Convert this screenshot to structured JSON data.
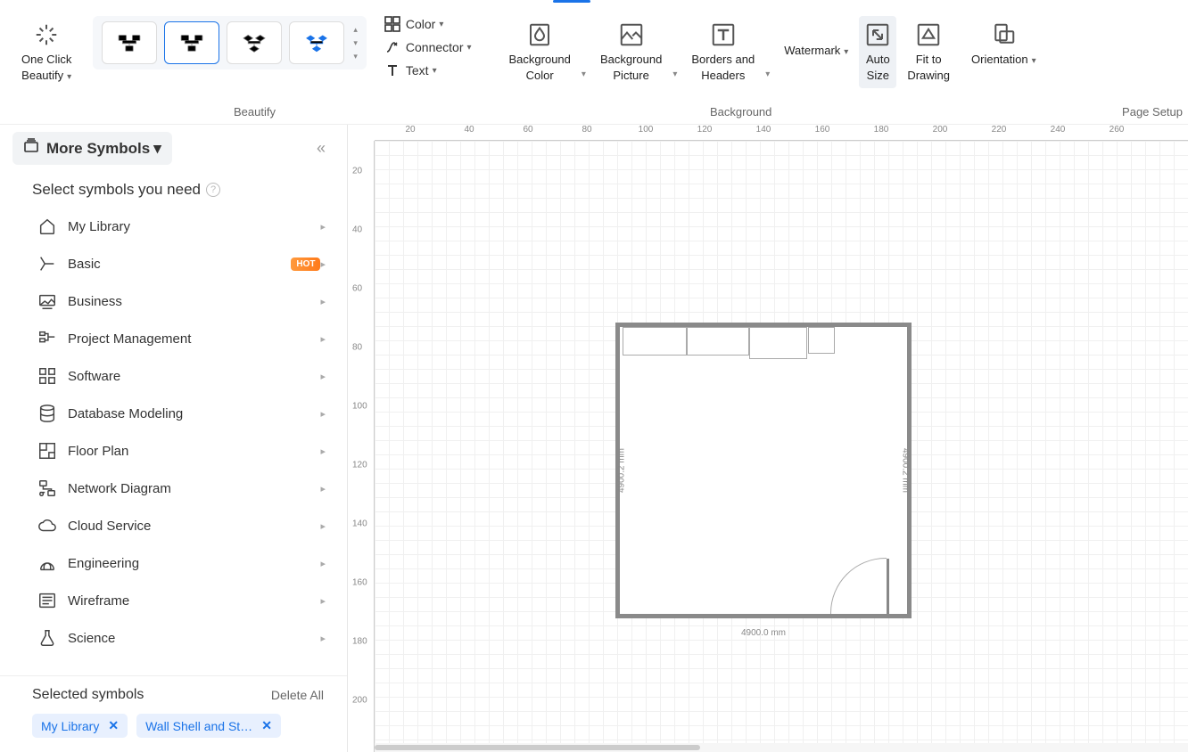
{
  "toolbar": {
    "one_click": "One Click\nBeautify",
    "color": "Color",
    "connector": "Connector",
    "text": "Text",
    "bg_color": "Background\nColor",
    "bg_picture": "Background\nPicture",
    "borders": "Borders and\nHeaders",
    "watermark": "Watermark",
    "auto_size": "Auto\nSize",
    "fit": "Fit to\nDrawing",
    "orientation": "Orientation",
    "section_beautify": "Beautify",
    "section_background": "Background",
    "section_pagesetup": "Page Setup"
  },
  "sidebar": {
    "more_symbols": "More Symbols",
    "select_title": "Select symbols you need",
    "categories": [
      {
        "label": "My Library",
        "hot": false
      },
      {
        "label": "Basic",
        "hot": true
      },
      {
        "label": "Business",
        "hot": false
      },
      {
        "label": "Project Management",
        "hot": false
      },
      {
        "label": "Software",
        "hot": false
      },
      {
        "label": "Database Modeling",
        "hot": false
      },
      {
        "label": "Floor Plan",
        "hot": false
      },
      {
        "label": "Network Diagram",
        "hot": false
      },
      {
        "label": "Cloud Service",
        "hot": false
      },
      {
        "label": "Engineering",
        "hot": false
      },
      {
        "label": "Wireframe",
        "hot": false
      },
      {
        "label": "Science",
        "hot": false
      }
    ],
    "selected_title": "Selected symbols",
    "delete_all": "Delete All",
    "chips": [
      "My Library",
      "Wall Shell and St…"
    ],
    "hot_label": "HOT"
  },
  "canvas": {
    "ruler_h": [
      "20",
      "40",
      "60",
      "80",
      "100",
      "120",
      "140",
      "160",
      "180",
      "200",
      "220",
      "240",
      "260"
    ],
    "ruler_v": [
      "20",
      "40",
      "60",
      "80",
      "100",
      "120",
      "140",
      "160",
      "180",
      "200"
    ],
    "dim_bottom": "4900.0 mm",
    "dim_left": "4900.2 mm",
    "dim_right": "4900.2 mm"
  }
}
